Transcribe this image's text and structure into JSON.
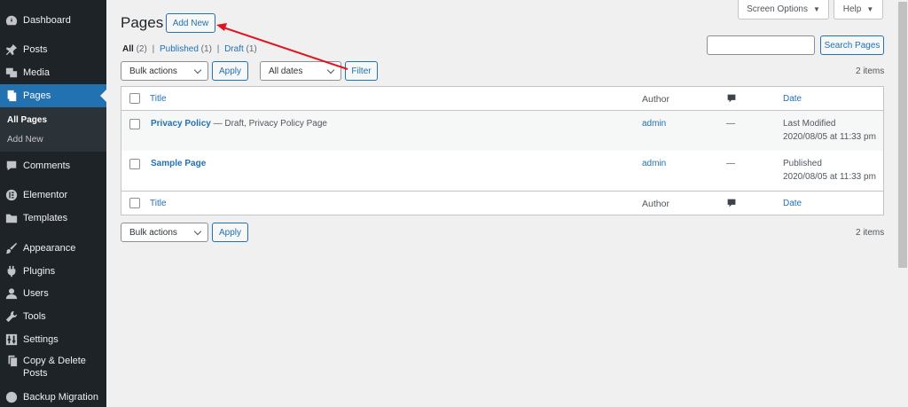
{
  "sidebar": {
    "items": [
      {
        "label": "Dashboard",
        "icon": "dashboard-icon"
      },
      {
        "label": "Posts",
        "icon": "pin-icon"
      },
      {
        "label": "Media",
        "icon": "media-icon"
      },
      {
        "label": "Pages",
        "icon": "pages-icon"
      },
      {
        "label": "Comments",
        "icon": "comment-icon"
      },
      {
        "label": "Elementor",
        "icon": "elementor-icon"
      },
      {
        "label": "Templates",
        "icon": "folder-icon"
      },
      {
        "label": "Appearance",
        "icon": "brush-icon"
      },
      {
        "label": "Plugins",
        "icon": "plugin-icon"
      },
      {
        "label": "Users",
        "icon": "user-icon"
      },
      {
        "label": "Tools",
        "icon": "wrench-icon"
      },
      {
        "label": "Settings",
        "icon": "settings-icon"
      },
      {
        "label": "Copy & Delete Posts",
        "icon": "copy-icon"
      },
      {
        "label": "Backup Migration",
        "icon": "backup-icon"
      }
    ],
    "submenu": [
      {
        "label": "All Pages"
      },
      {
        "label": "Add New"
      }
    ]
  },
  "topbar": {
    "screen_options": "Screen Options",
    "help": "Help"
  },
  "header": {
    "title": "Pages",
    "add_new": "Add New"
  },
  "filters": {
    "all": "All",
    "all_count": "(2)",
    "sep1": "|",
    "published": "Published",
    "published_count": "(1)",
    "sep2": "|",
    "draft": "Draft",
    "draft_count": "(1)"
  },
  "toolbar": {
    "bulk_actions": "Bulk actions",
    "apply": "Apply",
    "all_dates": "All dates",
    "filter": "Filter",
    "search_button": "Search Pages",
    "search_placeholder": "",
    "items_count": "2 items"
  },
  "table": {
    "columns": {
      "title": "Title",
      "author": "Author",
      "date": "Date"
    },
    "rows": [
      {
        "title": "Privacy Policy",
        "state": " — Draft, Privacy Policy Page",
        "author": "admin",
        "comments": "—",
        "date_status": "Last Modified",
        "date_value": "2020/08/05 at 11:33 pm"
      },
      {
        "title": "Sample Page",
        "state": "",
        "author": "admin",
        "comments": "—",
        "date_status": "Published",
        "date_value": "2020/08/05 at 11:33 pm"
      }
    ]
  },
  "bottom_toolbar": {
    "bulk_actions": "Bulk actions",
    "apply": "Apply",
    "items_count": "2 items"
  },
  "colors": {
    "sidebar_bg": "#1d2327",
    "accent": "#2271b1",
    "annotation_arrow": "#e3131b"
  }
}
